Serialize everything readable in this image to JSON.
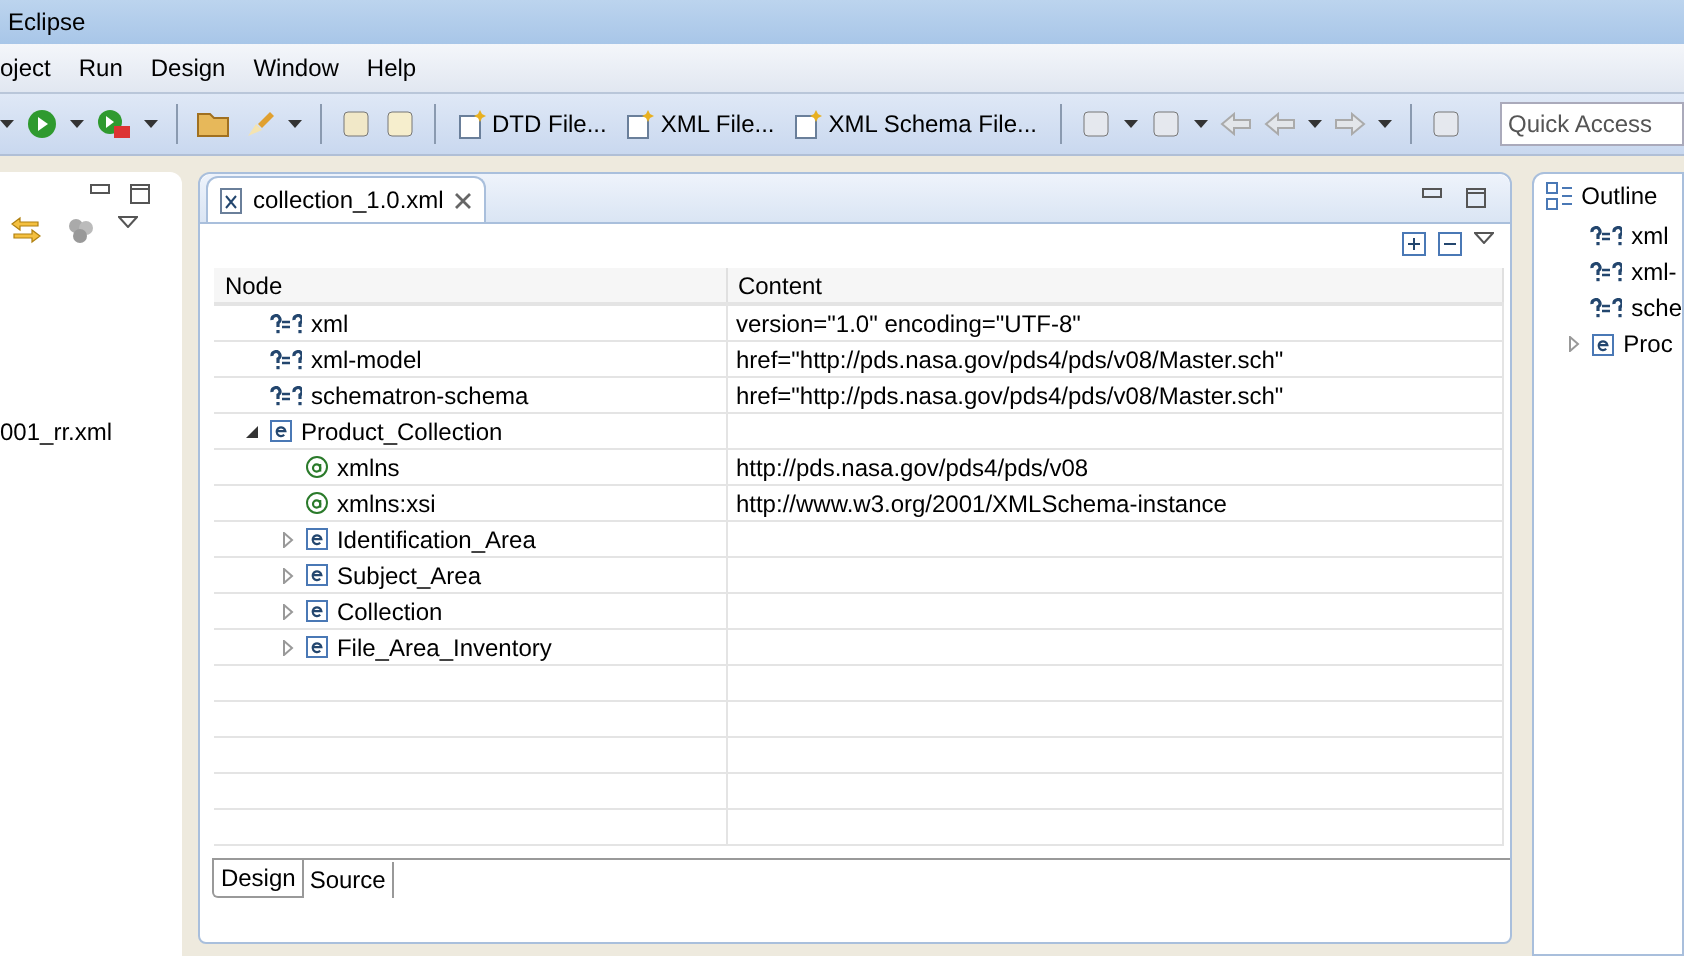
{
  "window": {
    "title": "Eclipse"
  },
  "menu": [
    "oject",
    "Run",
    "Design",
    "Window",
    "Help"
  ],
  "toolbar": {
    "wizards": [
      "DTD File...",
      "XML File...",
      "XML Schema File..."
    ],
    "quick_access": {
      "placeholder": "Quick Access"
    }
  },
  "left_panel": {
    "file": "001_rr.xml"
  },
  "editor": {
    "tab": "collection_1.0.xml",
    "columns": [
      "Node",
      "Content"
    ],
    "tree": [
      {
        "kind": "pi",
        "name": "xml",
        "content": "version=\"1.0\" encoding=\"UTF-8\""
      },
      {
        "kind": "pi",
        "name": "xml-model",
        "content": "href=\"http://pds.nasa.gov/pds4/pds/v08/Master.sch\""
      },
      {
        "kind": "pi",
        "name": "schematron-schema",
        "content": "href=\"http://pds.nasa.gov/pds4/pds/v08/Master.sch\""
      },
      {
        "kind": "element",
        "name": "Product_Collection",
        "expanded": true,
        "children": [
          {
            "kind": "attribute",
            "name": "xmlns",
            "content": "http://pds.nasa.gov/pds4/pds/v08"
          },
          {
            "kind": "attribute",
            "name": "xmlns:xsi",
            "content": "http://www.w3.org/2001/XMLSchema-instance"
          },
          {
            "kind": "element",
            "name": "Identification_Area",
            "expanded": false
          },
          {
            "kind": "element",
            "name": "Subject_Area",
            "expanded": false
          },
          {
            "kind": "element",
            "name": "Collection",
            "expanded": false
          },
          {
            "kind": "element",
            "name": "File_Area_Inventory",
            "expanded": false
          }
        ]
      }
    ],
    "bottom_tabs": [
      {
        "label": "Design",
        "selected": true
      },
      {
        "label": "Source",
        "selected": false
      }
    ]
  },
  "outline": {
    "title": "Outline",
    "items": [
      {
        "kind": "pi",
        "name": "xml"
      },
      {
        "kind": "pi",
        "name": "xml-"
      },
      {
        "kind": "pi",
        "name": "sche"
      },
      {
        "kind": "element",
        "name": "Proc",
        "expanded": false
      }
    ]
  }
}
